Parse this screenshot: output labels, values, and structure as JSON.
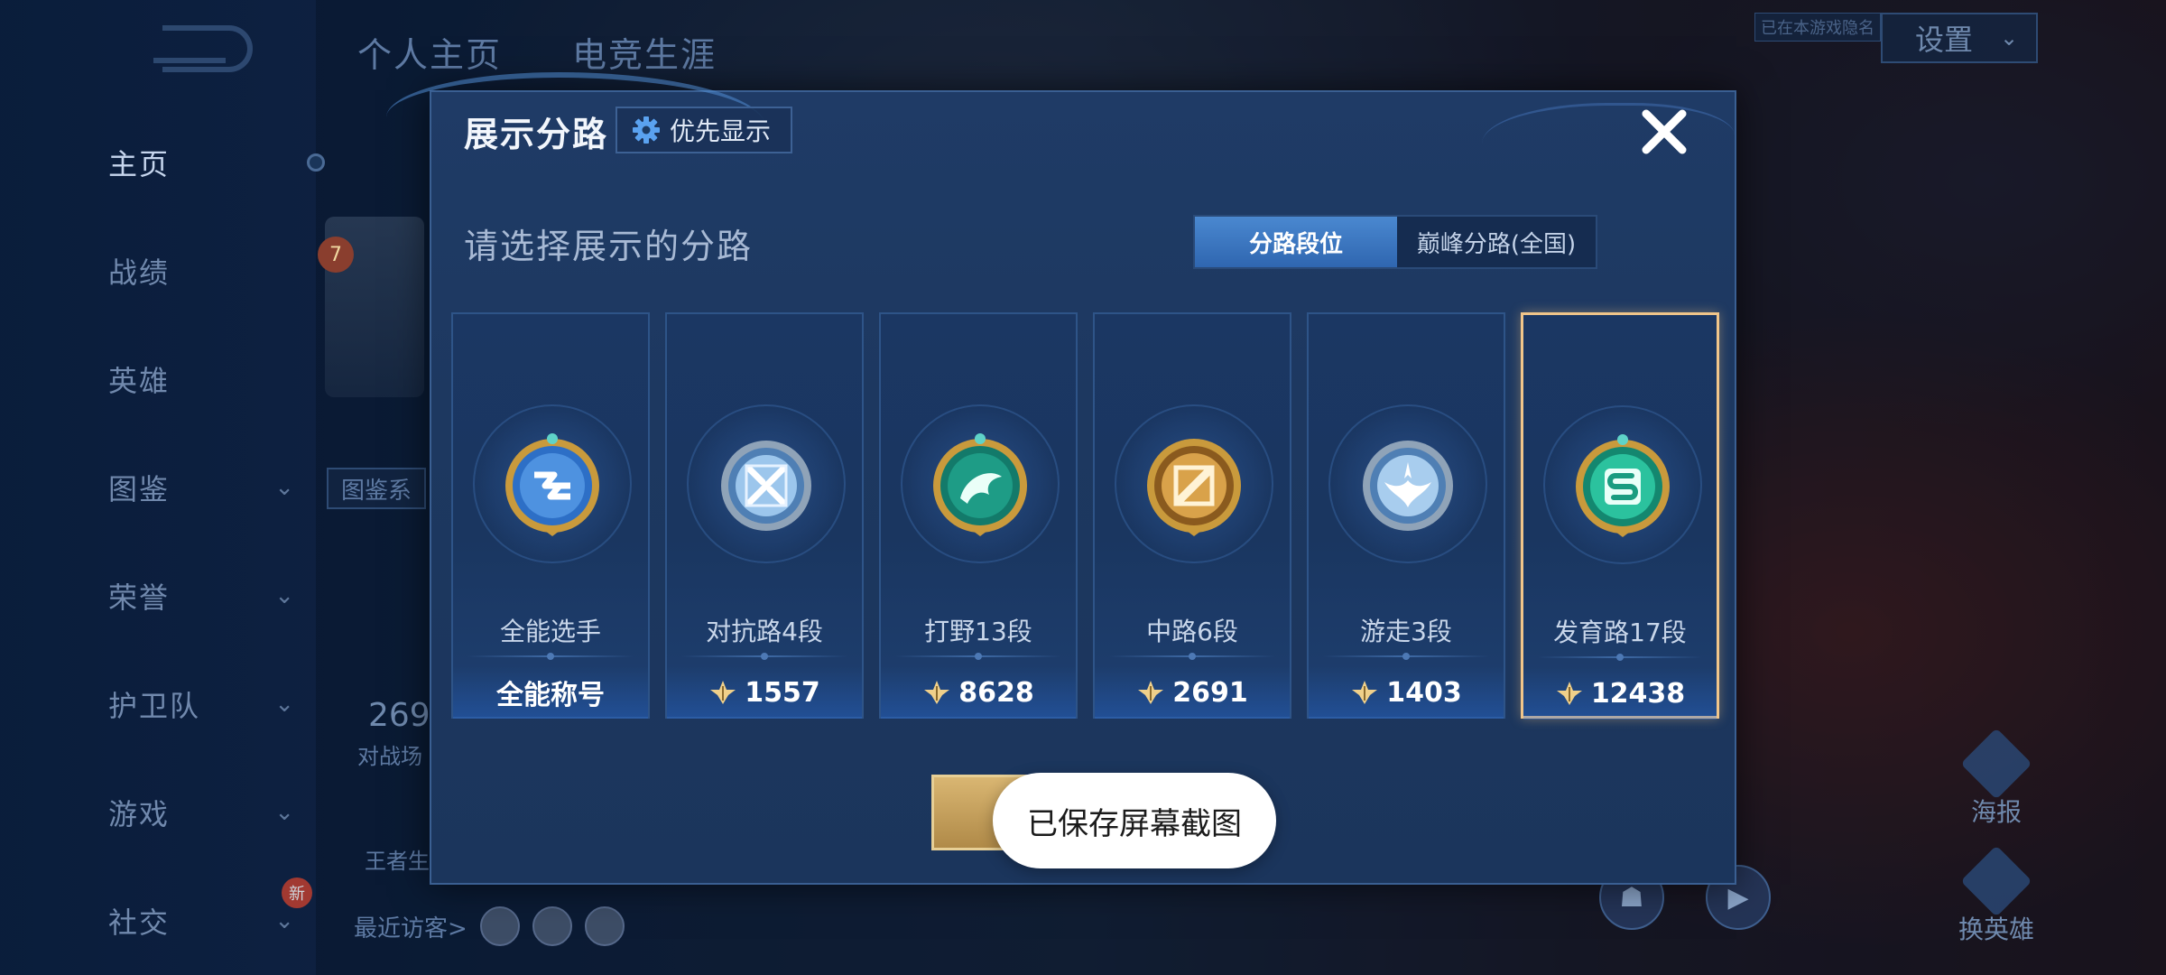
{
  "header": {
    "tabs": [
      "个人主页",
      "电竞生涯"
    ],
    "hidden_tag": "已在本游戏隐名",
    "settings_label": "设置"
  },
  "sidebar": {
    "items": [
      {
        "label": "主页",
        "chevron": false
      },
      {
        "label": "战绩",
        "chevron": false
      },
      {
        "label": "英雄",
        "chevron": false
      },
      {
        "label": "图鉴",
        "chevron": true
      },
      {
        "label": "荣誉",
        "chevron": true
      },
      {
        "label": "护卫队",
        "chevron": true
      },
      {
        "label": "游戏",
        "chevron": true
      },
      {
        "label": "社交",
        "chevron": true
      }
    ],
    "new_badge": "新"
  },
  "background": {
    "level": "7",
    "tujian": "图鉴系",
    "stat_value": "269",
    "stat_label": "对战场",
    "king_label": "王者生",
    "visitors_label": "最近访客>",
    "poster_label": "海报",
    "swap_hero_label": "换英雄",
    "new_tag": "新"
  },
  "modal": {
    "title": "展示分路",
    "priority_button": "优先显示",
    "subtitle": "请选择展示的分路",
    "segments": [
      {
        "label": "分路段位",
        "active": true
      },
      {
        "label": "巅峰分路(全国)",
        "active": false
      }
    ],
    "cards": [
      {
        "label": "全能选手",
        "value": "全能称号",
        "emblem": "all-round-emblem-icon",
        "has_points": false,
        "selected": false
      },
      {
        "label": "对抗路4段",
        "value": "1557",
        "emblem": "clash-lane-emblem-icon",
        "has_points": true,
        "selected": false
      },
      {
        "label": "打野13段",
        "value": "8628",
        "emblem": "jungle-emblem-icon",
        "has_points": true,
        "selected": false
      },
      {
        "label": "中路6段",
        "value": "2691",
        "emblem": "mid-lane-emblem-icon",
        "has_points": true,
        "selected": false
      },
      {
        "label": "游走3段",
        "value": "1403",
        "emblem": "roam-emblem-icon",
        "has_points": true,
        "selected": false
      },
      {
        "label": "发育路17段",
        "value": "12438",
        "emblem": "farm-lane-emblem-icon",
        "has_points": true,
        "selected": true
      }
    ]
  },
  "toast": {
    "message": "已保存屏幕截图"
  },
  "colors": {
    "accent_blue": "#3a7bd5",
    "selected_gold": "#f0c58a",
    "confirm_gold": "#c9a25c"
  }
}
